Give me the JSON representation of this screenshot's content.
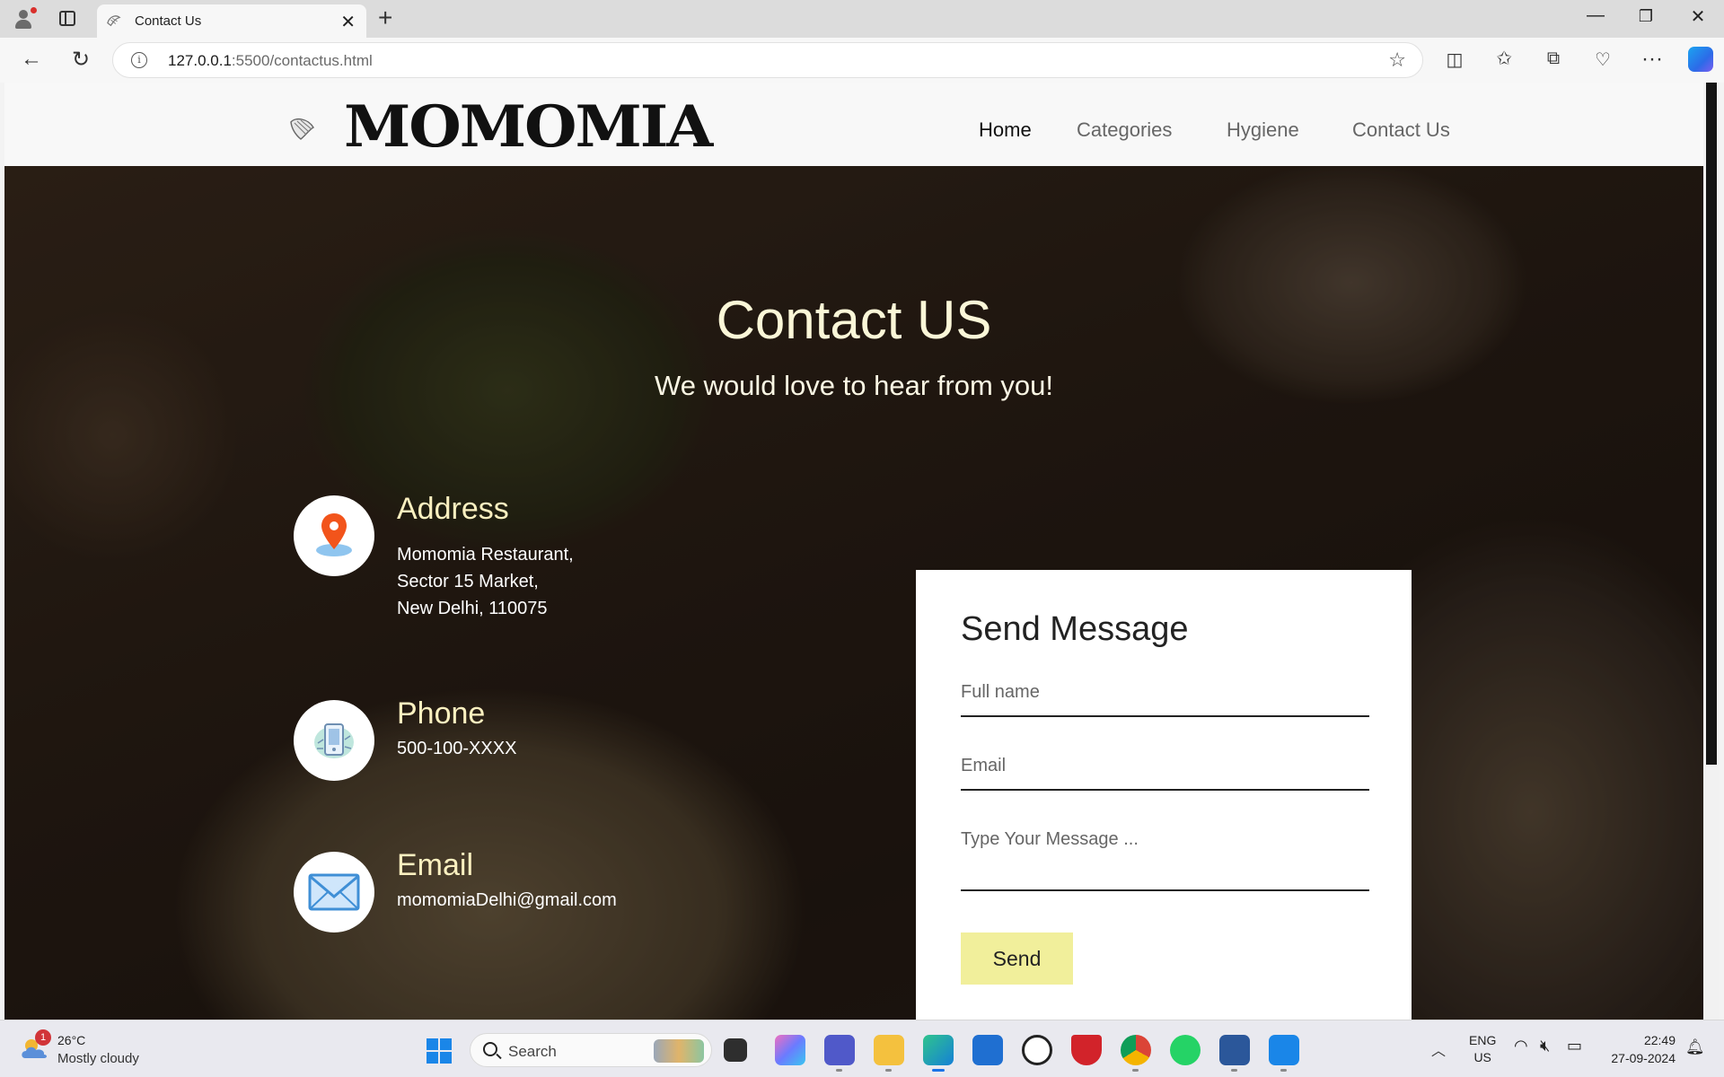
{
  "browser": {
    "tab_title": "Contact Us",
    "url_host": "127.0.0.1",
    "url_rest": ":5500/contactus.html"
  },
  "site": {
    "brand": "MOMOMIA",
    "nav": [
      {
        "label": "Home",
        "active": true
      },
      {
        "label": "Categories",
        "active": false
      },
      {
        "label": "Hygiene",
        "active": false
      },
      {
        "label": "Contact Us",
        "active": false
      }
    ]
  },
  "hero": {
    "title": "Contact US",
    "subtitle": "We would love to hear from you!"
  },
  "contact": {
    "address": {
      "label": "Address",
      "lines": [
        "Momomia Restaurant,",
        "Sector 15 Market,",
        "New Delhi, 110075"
      ]
    },
    "phone": {
      "label": "Phone",
      "value": "500-100-XXXX"
    },
    "email": {
      "label": "Email",
      "value": "momomiaDelhi@gmail.com"
    }
  },
  "form": {
    "heading": "Send Message",
    "fullname_placeholder": "Full name",
    "email_placeholder": "Email",
    "message_placeholder": "Type Your Message ...",
    "send_label": "Send"
  },
  "taskbar": {
    "weather_badge": "1",
    "temperature": "26°C",
    "condition": "Mostly cloudy",
    "search_label": "Search",
    "lang_1": "ENG",
    "lang_2": "US",
    "time": "22:49",
    "date": "27-09-2024"
  },
  "colors": {
    "send_button": "#f1ef9b",
    "hero_title": "#fbf7d8",
    "info_label": "#fbf0c0",
    "taskbar_active": "#1a73e8"
  }
}
